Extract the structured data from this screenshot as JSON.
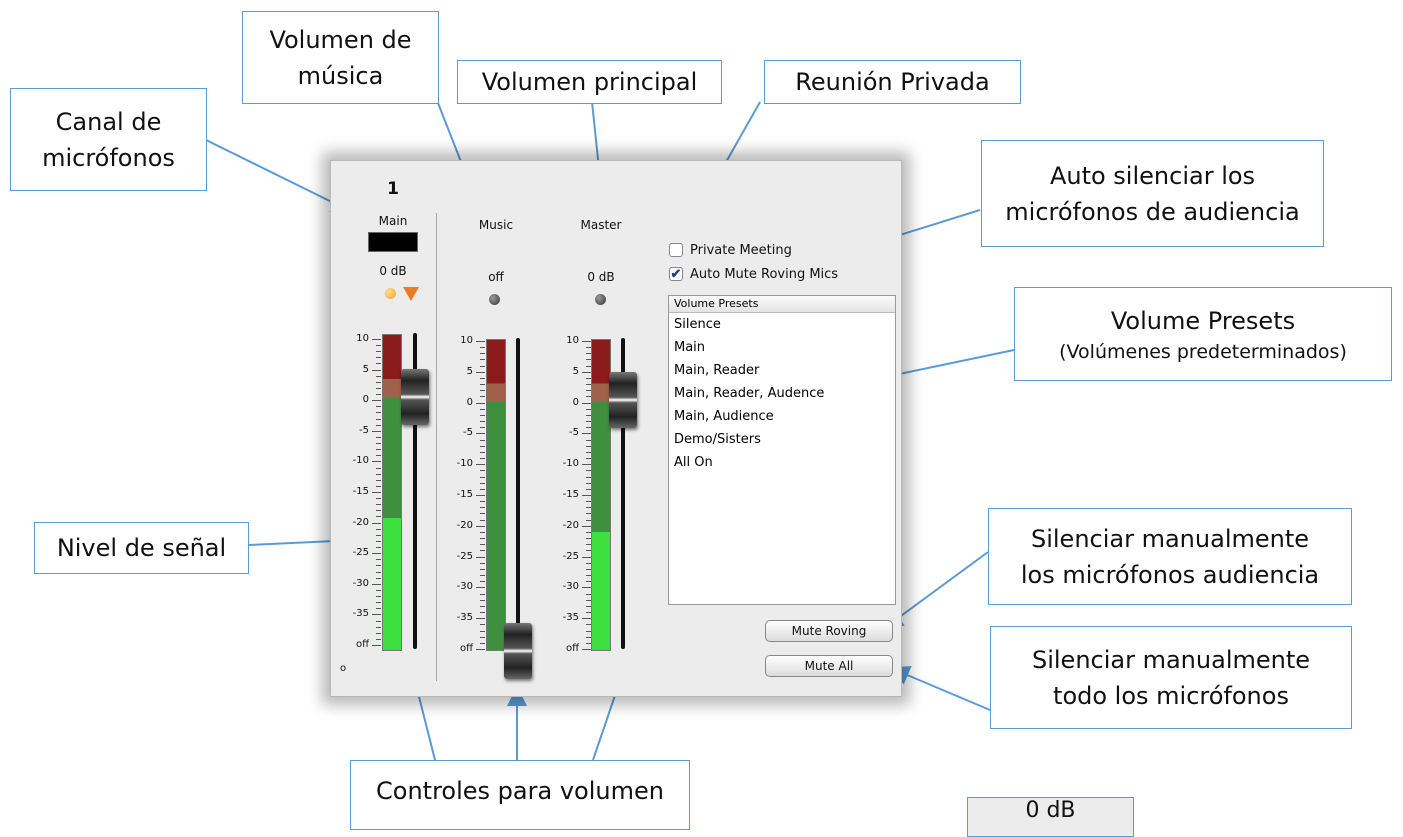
{
  "callouts": {
    "canal": [
      "Canal de",
      "micrófonos"
    ],
    "musica": [
      "Volumen de",
      "música"
    ],
    "principal": "Volumen principal",
    "reunion": "Reunión Privada",
    "auto_silenciar": [
      "Auto silenciar los",
      "micrófonos de audiencia"
    ],
    "presets": [
      "Volume Presets",
      "(Volúmenes predeterminados)"
    ],
    "nivel": "Nivel de señal",
    "silenciar_roving": [
      "Silenciar manualmente",
      "los micrófonos audiencia"
    ],
    "silenciar_todo": [
      "Silenciar manualmente",
      "todo los micrófonos"
    ],
    "controles": "Controles para volumen",
    "zoom": "0 dB"
  },
  "mixer": {
    "channel_number": "1",
    "channels": [
      {
        "name": "Main",
        "db": "0 dB",
        "signal_level_db": -19
      },
      {
        "name": "Music",
        "db": "off",
        "signal_level_db": null
      },
      {
        "name": "Master",
        "db": "0 dB",
        "signal_level_db": -21
      }
    ],
    "scale_labels": [
      "10",
      "5",
      "0",
      "-5",
      "-10",
      "-15",
      "-20",
      "-25",
      "-30",
      "-35",
      "off"
    ],
    "main_bottom_label": "o",
    "private_meeting": {
      "label": "Private Meeting",
      "checked": false
    },
    "auto_mute": {
      "label": "Auto Mute Roving Mics",
      "checked": true,
      "mark": "✔"
    },
    "presets_header": "Volume Presets",
    "presets": [
      "Silence",
      "Main",
      "Main, Reader",
      "Main, Reader, Audence",
      "Main, Audience",
      "Demo/Sisters",
      "All On"
    ],
    "mute_roving_label": "Mute Roving",
    "mute_all_label": "Mute All"
  },
  "colors": {
    "callout_border": "#5b9bd5",
    "meter_green": "#3de03d",
    "meter_red": "#8b1a1a",
    "amber_led": "#f0a030",
    "orange_arrow": "#f07a20"
  },
  "icons": [
    "status-led-icon",
    "orange-triangle-icon",
    "checkmark-icon"
  ]
}
